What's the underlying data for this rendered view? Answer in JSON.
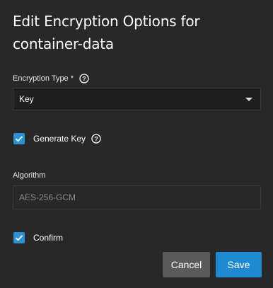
{
  "dialog": {
    "title": "Edit Encryption Options for container-data"
  },
  "encryption_type": {
    "label": "Encryption Type *",
    "value": "Key",
    "help_icon": "help-circle-icon"
  },
  "generate_key": {
    "label": "Generate Key",
    "checked": true,
    "help_icon": "help-circle-icon"
  },
  "algorithm": {
    "label": "Algorithm",
    "placeholder": "AES-256-GCM"
  },
  "confirm": {
    "label": "Confirm",
    "checked": true
  },
  "actions": {
    "cancel_label": "Cancel",
    "save_label": "Save"
  },
  "colors": {
    "background": "#282828",
    "accent": "#1f8ad4",
    "checkbox": "#2a93d5",
    "cancel_button": "#5a5a5a"
  }
}
